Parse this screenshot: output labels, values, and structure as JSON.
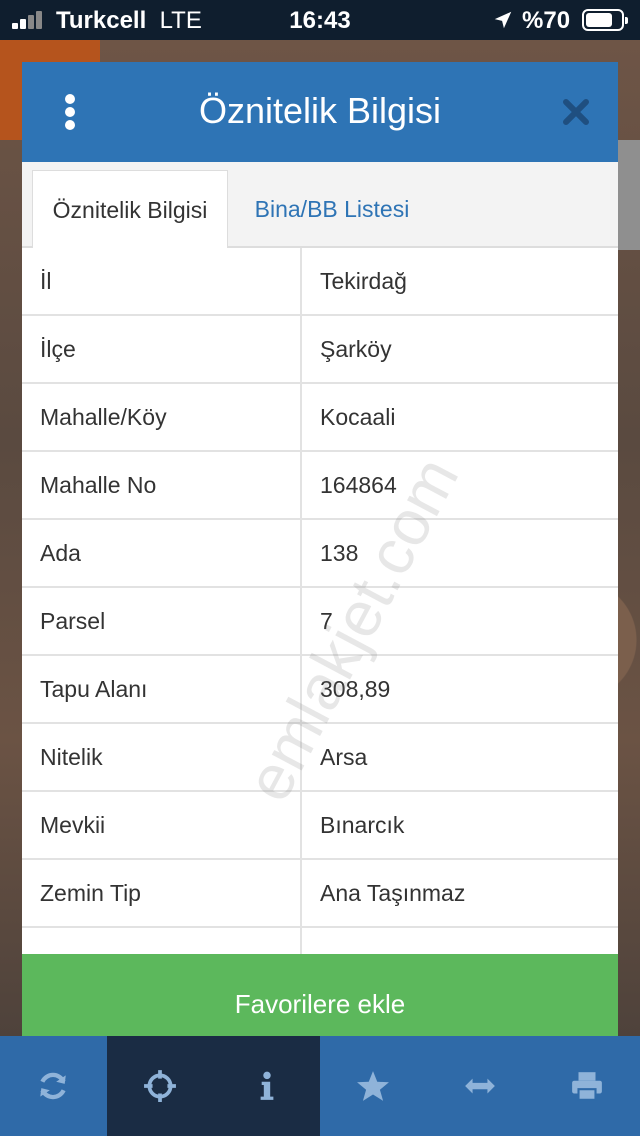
{
  "status_bar": {
    "carrier": "Turkcell",
    "network": "LTE",
    "time": "16:43",
    "battery": "%70"
  },
  "modal": {
    "title": "Öznitelik Bilgisi",
    "tabs": [
      {
        "label": "Öznitelik Bilgisi",
        "active": true
      },
      {
        "label": "Bina/BB Listesi",
        "active": false
      }
    ],
    "rows": [
      {
        "label": "İl",
        "value": "Tekirdağ"
      },
      {
        "label": "İlçe",
        "value": "Şarköy"
      },
      {
        "label": "Mahalle/Köy",
        "value": "Kocaali"
      },
      {
        "label": "Mahalle No",
        "value": "164864"
      },
      {
        "label": "Ada",
        "value": "138"
      },
      {
        "label": "Parsel",
        "value": "7"
      },
      {
        "label": "Tapu Alanı",
        "value": "308,89"
      },
      {
        "label": "Nitelik",
        "value": "Arsa"
      },
      {
        "label": "Mevkii",
        "value": "Bınarcık"
      },
      {
        "label": "Zemin Tip",
        "value": "Ana Taşınmaz"
      }
    ],
    "favorite_button": "Favorilere ekle"
  },
  "watermark": "emlakjet.com",
  "toolbar": {
    "items": [
      {
        "icon": "refresh-icon"
      },
      {
        "icon": "crosshair-icon"
      },
      {
        "icon": "info-icon"
      },
      {
        "icon": "star-icon"
      },
      {
        "icon": "measure-icon"
      },
      {
        "icon": "print-icon"
      }
    ]
  },
  "colors": {
    "header": "#2e74b5",
    "favorite_button": "#5cb85c",
    "toolbar": "#2f6aa8",
    "toolbar_active": "#1a2c44"
  }
}
